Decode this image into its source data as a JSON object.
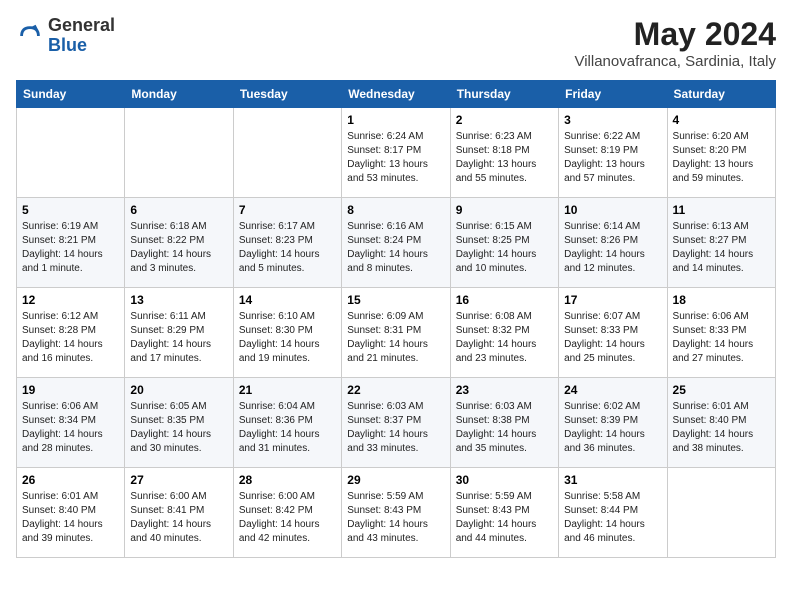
{
  "logo": {
    "general": "General",
    "blue": "Blue"
  },
  "title": {
    "month_year": "May 2024",
    "location": "Villanovafranca, Sardinia, Italy"
  },
  "weekdays": [
    "Sunday",
    "Monday",
    "Tuesday",
    "Wednesday",
    "Thursday",
    "Friday",
    "Saturday"
  ],
  "weeks": [
    [
      {
        "day": "",
        "info": ""
      },
      {
        "day": "",
        "info": ""
      },
      {
        "day": "",
        "info": ""
      },
      {
        "day": "1",
        "info": "Sunrise: 6:24 AM\nSunset: 8:17 PM\nDaylight: 13 hours\nand 53 minutes."
      },
      {
        "day": "2",
        "info": "Sunrise: 6:23 AM\nSunset: 8:18 PM\nDaylight: 13 hours\nand 55 minutes."
      },
      {
        "day": "3",
        "info": "Sunrise: 6:22 AM\nSunset: 8:19 PM\nDaylight: 13 hours\nand 57 minutes."
      },
      {
        "day": "4",
        "info": "Sunrise: 6:20 AM\nSunset: 8:20 PM\nDaylight: 13 hours\nand 59 minutes."
      }
    ],
    [
      {
        "day": "5",
        "info": "Sunrise: 6:19 AM\nSunset: 8:21 PM\nDaylight: 14 hours\nand 1 minute."
      },
      {
        "day": "6",
        "info": "Sunrise: 6:18 AM\nSunset: 8:22 PM\nDaylight: 14 hours\nand 3 minutes."
      },
      {
        "day": "7",
        "info": "Sunrise: 6:17 AM\nSunset: 8:23 PM\nDaylight: 14 hours\nand 5 minutes."
      },
      {
        "day": "8",
        "info": "Sunrise: 6:16 AM\nSunset: 8:24 PM\nDaylight: 14 hours\nand 8 minutes."
      },
      {
        "day": "9",
        "info": "Sunrise: 6:15 AM\nSunset: 8:25 PM\nDaylight: 14 hours\nand 10 minutes."
      },
      {
        "day": "10",
        "info": "Sunrise: 6:14 AM\nSunset: 8:26 PM\nDaylight: 14 hours\nand 12 minutes."
      },
      {
        "day": "11",
        "info": "Sunrise: 6:13 AM\nSunset: 8:27 PM\nDaylight: 14 hours\nand 14 minutes."
      }
    ],
    [
      {
        "day": "12",
        "info": "Sunrise: 6:12 AM\nSunset: 8:28 PM\nDaylight: 14 hours\nand 16 minutes."
      },
      {
        "day": "13",
        "info": "Sunrise: 6:11 AM\nSunset: 8:29 PM\nDaylight: 14 hours\nand 17 minutes."
      },
      {
        "day": "14",
        "info": "Sunrise: 6:10 AM\nSunset: 8:30 PM\nDaylight: 14 hours\nand 19 minutes."
      },
      {
        "day": "15",
        "info": "Sunrise: 6:09 AM\nSunset: 8:31 PM\nDaylight: 14 hours\nand 21 minutes."
      },
      {
        "day": "16",
        "info": "Sunrise: 6:08 AM\nSunset: 8:32 PM\nDaylight: 14 hours\nand 23 minutes."
      },
      {
        "day": "17",
        "info": "Sunrise: 6:07 AM\nSunset: 8:33 PM\nDaylight: 14 hours\nand 25 minutes."
      },
      {
        "day": "18",
        "info": "Sunrise: 6:06 AM\nSunset: 8:33 PM\nDaylight: 14 hours\nand 27 minutes."
      }
    ],
    [
      {
        "day": "19",
        "info": "Sunrise: 6:06 AM\nSunset: 8:34 PM\nDaylight: 14 hours\nand 28 minutes."
      },
      {
        "day": "20",
        "info": "Sunrise: 6:05 AM\nSunset: 8:35 PM\nDaylight: 14 hours\nand 30 minutes."
      },
      {
        "day": "21",
        "info": "Sunrise: 6:04 AM\nSunset: 8:36 PM\nDaylight: 14 hours\nand 31 minutes."
      },
      {
        "day": "22",
        "info": "Sunrise: 6:03 AM\nSunset: 8:37 PM\nDaylight: 14 hours\nand 33 minutes."
      },
      {
        "day": "23",
        "info": "Sunrise: 6:03 AM\nSunset: 8:38 PM\nDaylight: 14 hours\nand 35 minutes."
      },
      {
        "day": "24",
        "info": "Sunrise: 6:02 AM\nSunset: 8:39 PM\nDaylight: 14 hours\nand 36 minutes."
      },
      {
        "day": "25",
        "info": "Sunrise: 6:01 AM\nSunset: 8:40 PM\nDaylight: 14 hours\nand 38 minutes."
      }
    ],
    [
      {
        "day": "26",
        "info": "Sunrise: 6:01 AM\nSunset: 8:40 PM\nDaylight: 14 hours\nand 39 minutes."
      },
      {
        "day": "27",
        "info": "Sunrise: 6:00 AM\nSunset: 8:41 PM\nDaylight: 14 hours\nand 40 minutes."
      },
      {
        "day": "28",
        "info": "Sunrise: 6:00 AM\nSunset: 8:42 PM\nDaylight: 14 hours\nand 42 minutes."
      },
      {
        "day": "29",
        "info": "Sunrise: 5:59 AM\nSunset: 8:43 PM\nDaylight: 14 hours\nand 43 minutes."
      },
      {
        "day": "30",
        "info": "Sunrise: 5:59 AM\nSunset: 8:43 PM\nDaylight: 14 hours\nand 44 minutes."
      },
      {
        "day": "31",
        "info": "Sunrise: 5:58 AM\nSunset: 8:44 PM\nDaylight: 14 hours\nand 46 minutes."
      },
      {
        "day": "",
        "info": ""
      }
    ]
  ]
}
